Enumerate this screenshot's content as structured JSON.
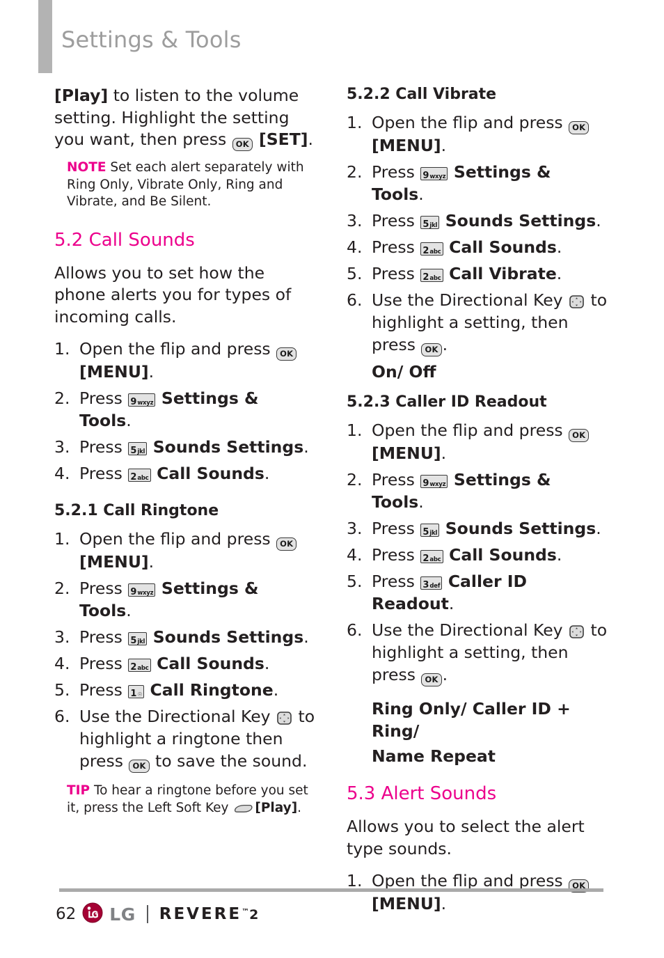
{
  "header": {
    "title": "Settings & Tools"
  },
  "left_column": {
    "intro_paragraph": {
      "part1_bold": "[Play]",
      "part2": " to listen to the volume setting. Highlight the setting you want, then press ",
      "key_after": "OK",
      "part3_bold": " [SET]",
      "part4": "."
    },
    "note": {
      "tag": "NOTE",
      "text": " Set each alert separately with Ring Only, Vibrate Only, Ring and Vibrate, and Be Silent."
    },
    "section_5_2": {
      "heading": "5.2 Call Sounds",
      "description": "Allows you to set how the phone alerts you for types of incoming calls.",
      "steps": [
        {
          "num": "1.",
          "pre": "Open the flip and press ",
          "key": {
            "type": "ok",
            "label": "OK"
          },
          "post_bold": "",
          "post": "",
          "tail_bold": "[MENU]",
          "tail": "."
        },
        {
          "num": "2.",
          "pre": "Press ",
          "key": {
            "type": "digit",
            "digit": "9",
            "letters": "wxyz"
          },
          "post_bold": "Settings & Tools",
          "post": "."
        },
        {
          "num": "3.",
          "pre": "Press ",
          "key": {
            "type": "digit",
            "digit": "5",
            "letters": "jkl"
          },
          "post_bold": "Sounds Settings",
          "post": "."
        },
        {
          "num": "4.",
          "pre": "Press ",
          "key": {
            "type": "digit",
            "digit": "2",
            "letters": "abc"
          },
          "post_bold": "Call Sounds",
          "post": "."
        }
      ]
    },
    "section_5_2_1": {
      "heading": "5.2.1 Call Ringtone",
      "steps": [
        {
          "num": "1.",
          "pre": "Open the flip and press ",
          "key": {
            "type": "ok",
            "label": "OK"
          },
          "tail_bold": "[MENU]",
          "tail": "."
        },
        {
          "num": "2.",
          "pre": "Press ",
          "key": {
            "type": "digit",
            "digit": "9",
            "letters": "wxyz"
          },
          "post_bold": "Settings & Tools",
          "post": "."
        },
        {
          "num": "3.",
          "pre": "Press ",
          "key": {
            "type": "digit",
            "digit": "5",
            "letters": "jkl"
          },
          "post_bold": "Sounds Settings",
          "post": "."
        },
        {
          "num": "4.",
          "pre": "Press ",
          "key": {
            "type": "digit",
            "digit": "2",
            "letters": "abc"
          },
          "post_bold": "Call Sounds",
          "post": "."
        },
        {
          "num": "5.",
          "pre": "Press ",
          "key": {
            "type": "digit",
            "digit": "1",
            "letters": "☉"
          },
          "post_bold": "Call Ringtone",
          "post": "."
        },
        {
          "num": "6.",
          "pre": "Use the Directional Key ",
          "key": {
            "type": "dir"
          },
          "post": " to highlight a ringtone then press ",
          "key2": {
            "type": "ok",
            "label": "OK"
          },
          "post2": " to save the sound."
        }
      ]
    },
    "tip": {
      "tag": "TIP",
      "text_before": " To hear a ringtone before you set it, press the Left Soft Key ",
      "key": "left-soft-key",
      "text_bold": "[Play]",
      "text_after": "."
    }
  },
  "right_column": {
    "section_5_2_2": {
      "heading": "5.2.2 Call Vibrate",
      "steps": [
        {
          "num": "1.",
          "pre": "Open the flip and press ",
          "key": {
            "type": "ok",
            "label": "OK"
          },
          "tail_bold": "[MENU]",
          "tail": "."
        },
        {
          "num": "2.",
          "pre": "Press ",
          "key": {
            "type": "digit",
            "digit": "9",
            "letters": "wxyz"
          },
          "post_bold": "Settings & Tools",
          "post": "."
        },
        {
          "num": "3.",
          "pre": "Press ",
          "key": {
            "type": "digit",
            "digit": "5",
            "letters": "jkl"
          },
          "post_bold": "Sounds Settings",
          "post": "."
        },
        {
          "num": "4.",
          "pre": "Press ",
          "key": {
            "type": "digit",
            "digit": "2",
            "letters": "abc"
          },
          "post_bold": "Call Sounds",
          "post": "."
        },
        {
          "num": "5.",
          "pre": "Press ",
          "key": {
            "type": "digit",
            "digit": "2",
            "letters": "abc"
          },
          "post_bold": "Call Vibrate",
          "post": "."
        },
        {
          "num": "6.",
          "pre": "Use the Directional Key ",
          "key": {
            "type": "dir"
          },
          "post": " to highlight a setting, then press ",
          "key2": {
            "type": "ok",
            "label": "OK"
          },
          "post2": "."
        }
      ],
      "options": "On/ Off"
    },
    "section_5_2_3": {
      "heading": "5.2.3 Caller ID Readout",
      "steps": [
        {
          "num": "1.",
          "pre": "Open the flip and press ",
          "key": {
            "type": "ok",
            "label": "OK"
          },
          "tail_bold": "[MENU]",
          "tail": "."
        },
        {
          "num": "2.",
          "pre": "Press ",
          "key": {
            "type": "digit",
            "digit": "9",
            "letters": "wxyz"
          },
          "post_bold": "Settings & Tools",
          "post": "."
        },
        {
          "num": "3.",
          "pre": "Press ",
          "key": {
            "type": "digit",
            "digit": "5",
            "letters": "jkl"
          },
          "post_bold": "Sounds Settings",
          "post": "."
        },
        {
          "num": "4.",
          "pre": "Press ",
          "key": {
            "type": "digit",
            "digit": "2",
            "letters": "abc"
          },
          "post_bold": "Call Sounds",
          "post": "."
        },
        {
          "num": "5.",
          "pre": "Press ",
          "key": {
            "type": "digit",
            "digit": "3",
            "letters": "def"
          },
          "post_bold": "Caller ID Readout",
          "post": "."
        },
        {
          "num": "6.",
          "pre": "Use the Directional Key ",
          "key": {
            "type": "dir"
          },
          "post": " to highlight a setting, then press ",
          "key2": {
            "type": "ok",
            "label": "OK"
          },
          "post2": "."
        }
      ],
      "options_line1": "Ring Only/ Caller ID + Ring/",
      "options_line2": "Name Repeat"
    },
    "section_5_3": {
      "heading": "5.3 Alert Sounds",
      "description": "Allows you to select the alert type sounds.",
      "steps": [
        {
          "num": "1.",
          "pre": "Open the flip and press ",
          "key": {
            "type": "ok",
            "label": "OK"
          },
          "tail_bold": "[MENU]",
          "tail": "."
        }
      ]
    }
  },
  "footer": {
    "page_number": "62",
    "brand": "LG",
    "model": "REVERE",
    "model_tm": "™",
    "model_version": "2"
  },
  "colors": {
    "accent_pink": "#ec008c",
    "header_gray": "#9d9d9d",
    "bar_gray": "#b3b3b3",
    "rule_gray": "#aaaaaa",
    "lg_crimson": "#a50034",
    "body_text": "#231f20"
  }
}
